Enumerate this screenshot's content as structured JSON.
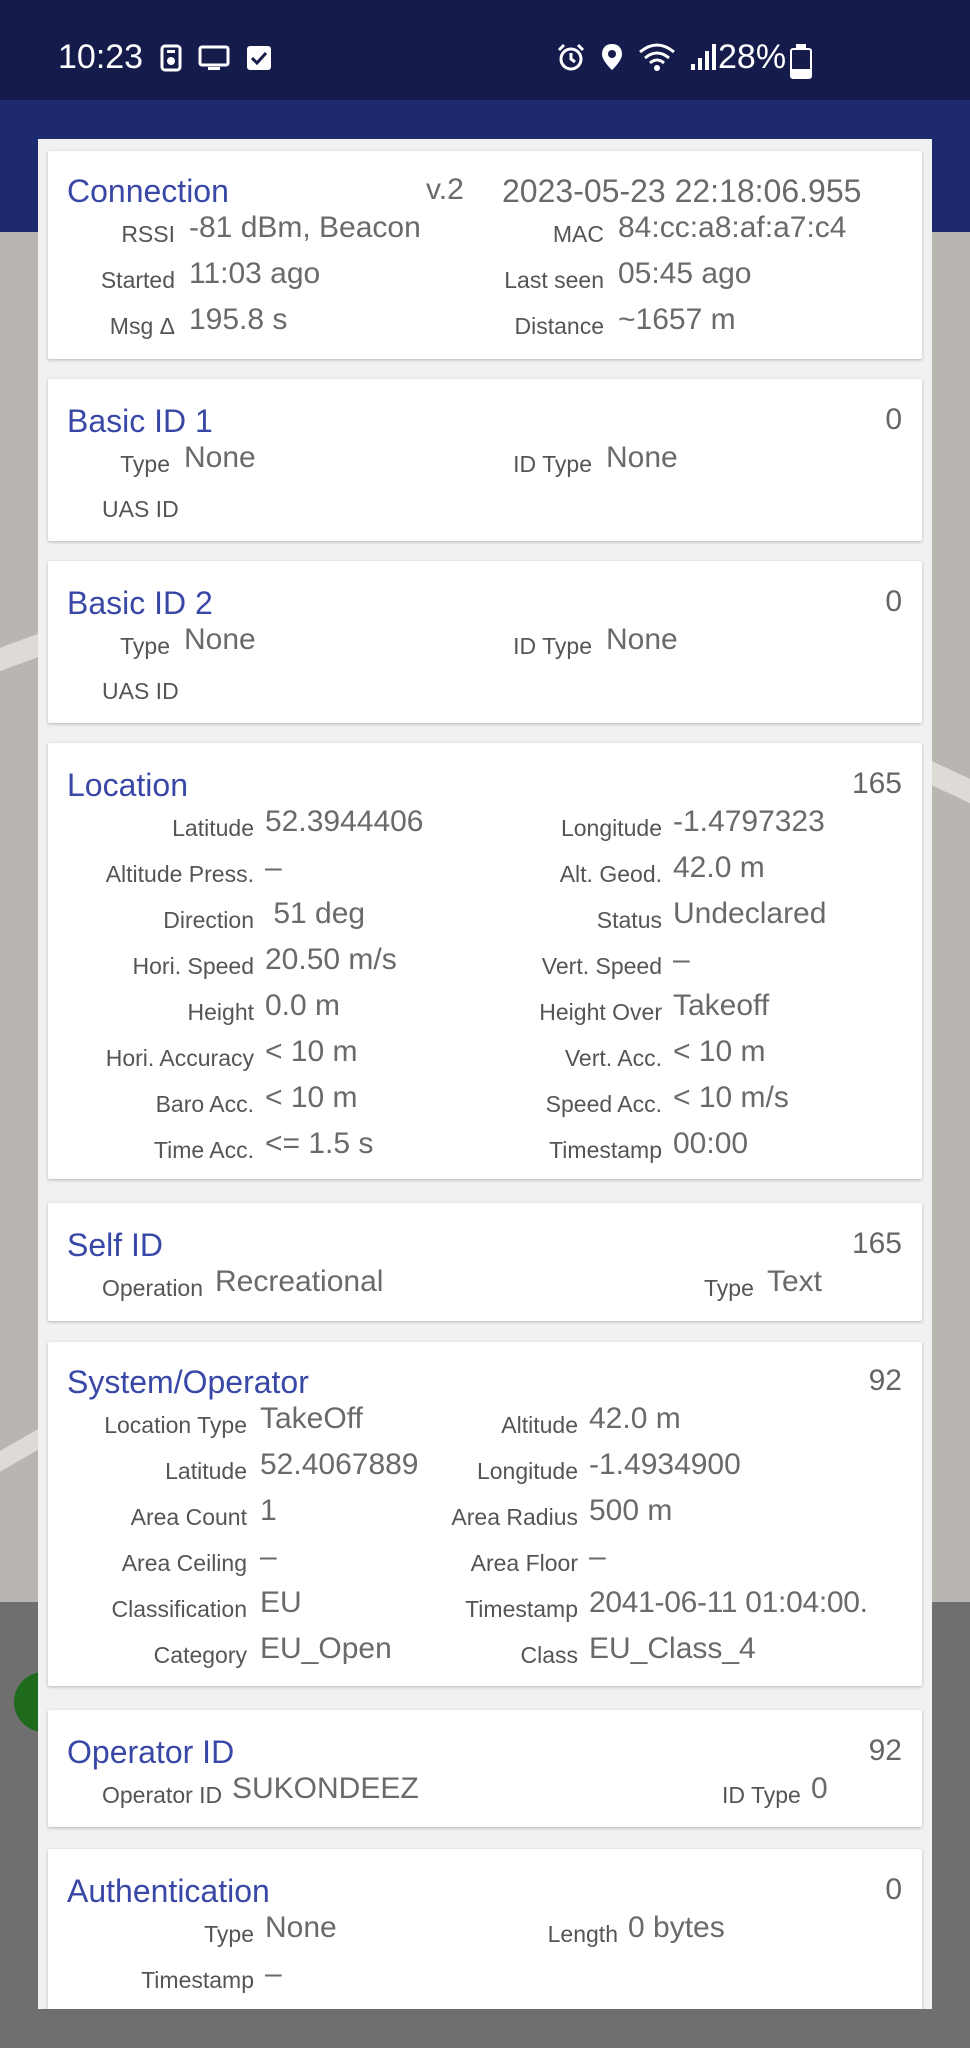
{
  "status_bar": {
    "time": "10:23",
    "battery_text": "28%",
    "battery_level": 0.28,
    "left_icons": [
      "camera-notification-icon",
      "cast-screen-icon",
      "checkbox-notification-icon"
    ],
    "right_icons": [
      "alarm-icon",
      "location-icon",
      "wifi-icon",
      "signal-icon"
    ]
  },
  "connection": {
    "title": "Connection",
    "version": "v.2",
    "datetime": "2023-05-23 22:18:06.955",
    "rssi_label": "RSSI",
    "rssi": "-81 dBm, Beacon",
    "mac_label": "MAC",
    "mac": "84:cc:a8:af:a7:c4",
    "started_label": "Started",
    "started": "11:03  ago",
    "last_seen_label": "Last seen",
    "last_seen": "05:45  ago",
    "msg_label": "Msg Δ",
    "msg": "195.8 s",
    "distance_label": "Distance",
    "distance": "~1657 m"
  },
  "basic_id_1": {
    "title": "Basic ID 1",
    "count": "0",
    "type_label": "Type",
    "type": "None",
    "id_type_label": "ID Type",
    "id_type": "None",
    "uas_id_label": "UAS ID"
  },
  "basic_id_2": {
    "title": "Basic ID 2",
    "count": "0",
    "type_label": "Type",
    "type": "None",
    "id_type_label": "ID Type",
    "id_type": "None",
    "uas_id_label": "UAS ID"
  },
  "location": {
    "title": "Location",
    "count": "165",
    "rows": [
      {
        "l1": "Latitude",
        "v1": "52.3944406",
        "l2": "Longitude",
        "v2": "-1.4797323"
      },
      {
        "l1": "Altitude Press.",
        "v1": "–",
        "l2": "Alt. Geod.",
        "v2": "42.0 m"
      },
      {
        "l1": "Direction",
        "v1": " 51 deg",
        "l2": "Status",
        "v2": "Undeclared"
      },
      {
        "l1": "Hori. Speed",
        "v1": "20.50 m/s",
        "l2": "Vert. Speed",
        "v2": "–"
      },
      {
        "l1": "Height",
        "v1": "0.0 m",
        "l2": "Height Over",
        "v2": "Takeoff"
      },
      {
        "l1": "Hori. Accuracy",
        "v1": "< 10 m",
        "l2": "Vert. Acc.",
        "v2": "< 10 m"
      },
      {
        "l1": "Baro Acc.",
        "v1": "< 10 m",
        "l2": "Speed Acc.",
        "v2": "< 10 m/s"
      },
      {
        "l1": "Time Acc.",
        "v1": "<= 1.5 s",
        "l2": "Timestamp",
        "v2": "00:00"
      }
    ]
  },
  "self_id": {
    "title": "Self ID",
    "count": "165",
    "operation_label": "Operation",
    "operation": "Recreational",
    "type_label": "Type",
    "type": "Text"
  },
  "system_operator": {
    "title": "System/Operator",
    "count": "92",
    "rows": [
      {
        "l1": "Location Type",
        "v1": "TakeOff",
        "l2": "Altitude",
        "v2": "42.0 m"
      },
      {
        "l1": "Latitude",
        "v1": "52.4067889",
        "l2": "Longitude",
        "v2": "-1.4934900"
      },
      {
        "l1": "Area Count",
        "v1": "1",
        "l2": "Area Radius",
        "v2": "500 m"
      },
      {
        "l1": "Area Ceiling",
        "v1": "–",
        "l2": "Area Floor",
        "v2": "–"
      },
      {
        "l1": "Classification",
        "v1": "EU",
        "l2": "Timestamp",
        "v2": "2041-06-11 01:04:00."
      },
      {
        "l1": "Category",
        "v1": "EU_Open",
        "l2": "Class",
        "v2": "EU_Class_4"
      }
    ]
  },
  "operator_id": {
    "title": "Operator ID",
    "count": "92",
    "operator_id_label": "Operator ID",
    "operator_id": "SUKONDEEZ",
    "id_type_label": "ID Type",
    "id_type": "0"
  },
  "authentication": {
    "title": "Authentication",
    "count": "0",
    "type_label": "Type",
    "type": "None",
    "length_label": "Length",
    "length": "0 bytes",
    "timestamp_label": "Timestamp",
    "timestamp": "–"
  }
}
